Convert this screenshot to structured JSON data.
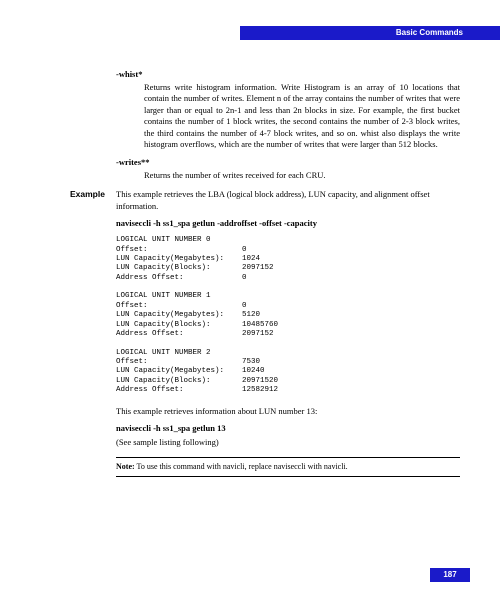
{
  "header": {
    "section": "Basic Commands"
  },
  "options": [
    {
      "name": "-whist*",
      "desc": "Returns write histogram information. Write Histogram is an array of 10 locations that contain the number of writes. Element n of the array contains the number of writes that were larger than or equal to 2n-1 and less than 2n blocks in size. For example, the first bucket contains the number of 1 block writes, the second contains the number of 2-3 block writes, the third contains the number of 4-7 block writes, and so on. whist also displays the write histogram overflows, which are the number of writes that were larger than 512 blocks."
    },
    {
      "name": "-writes**",
      "desc": "Returns the number of writes received for each CRU."
    }
  ],
  "example": {
    "label": "Example",
    "intro": "This example retrieves the LBA (logical block address), LUN capacity, and alignment offset information.",
    "command1": "naviseccli  -h  ss1_spa  getlun  -addroffset  -offset  -capacity",
    "code": "LOGICAL UNIT NUMBER 0\nOffset:                     0\nLUN Capacity(Megabytes):    1024\nLUN Capacity(Blocks):       2097152\nAddress Offset:             0\n\nLOGICAL UNIT NUMBER 1\nOffset:                     0\nLUN Capacity(Megabytes):    5120\nLUN Capacity(Blocks):       10485760\nAddress Offset:             2097152\n\nLOGICAL UNIT NUMBER 2\nOffset:                     7530\nLUN Capacity(Megabytes):    10240\nLUN Capacity(Blocks):       20971520\nAddress Offset:             12582912",
    "after1": "This example retrieves information about LUN number 13:",
    "command2": "naviseccli  -h  ss1_spa  getlun  13",
    "after2": "(See sample listing following)"
  },
  "note": {
    "label": "Note:",
    "text": " To use this command with navicli, replace naviseccli with navicli."
  },
  "page": "187"
}
